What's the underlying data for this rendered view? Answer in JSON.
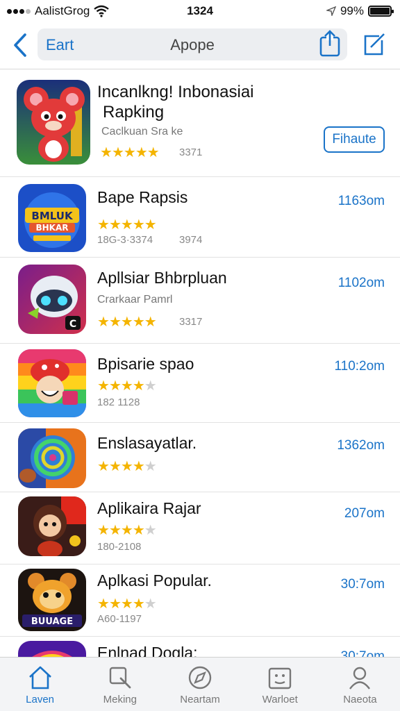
{
  "status_bar": {
    "carrier": "AalistGrog",
    "time": "1324",
    "battery": "99%",
    "battery_level": 0.99
  },
  "nav": {
    "back_label": "Eart",
    "title": "Apope"
  },
  "apps": [
    {
      "name_line1": "Incanlkng! Inbonasiai",
      "name_line2": "Rapking",
      "subtitle": "Caclkuan Sra ke",
      "stars_full": 4,
      "stars_half": 1,
      "rating_count": "3371",
      "action_label": "Fihaute",
      "icon": "red-mouse-app-icon"
    },
    {
      "name": "Bape Rapsis",
      "stars_full": 4,
      "stars_half": 1,
      "meta": "18G-3·3374",
      "rating_count": "3974",
      "size": "1163om",
      "icon": "bmluk-game-app-icon"
    },
    {
      "name": "Apllsiar Bhbrpluan",
      "subtitle": "Crarkaar Pamrl",
      "stars_full": 4,
      "stars_half": 1,
      "rating_count": "3317",
      "size": "1102om",
      "icon": "robot-app-icon"
    },
    {
      "name": "Bpisarie spao",
      "stars_full": 4,
      "stars_half": 0,
      "meta": "182 1128",
      "size": "110:2om",
      "icon": "mushroom-app-icon"
    },
    {
      "name": "Enslasayatlar.",
      "stars_full": 4,
      "stars_half": 0,
      "size": "1362om",
      "icon": "spiral-app-icon"
    },
    {
      "name": "Aplikaira Rajar",
      "stars_full": 4,
      "stars_half": 0,
      "meta": "180-2108",
      "size": "207om",
      "icon": "girl-character-app-icon"
    },
    {
      "name": "Aplkasi Popular.",
      "stars_full": 4,
      "stars_half": 0,
      "meta": "A60-1197",
      "size": "30:7om",
      "icon": "buuage-app-icon"
    },
    {
      "name": "Enlnad Dogla:",
      "size": "30:7om",
      "icon": "rainbow-app-icon"
    }
  ],
  "tabs": [
    {
      "label": "Laven",
      "icon": "home-icon",
      "active": true
    },
    {
      "label": "Meking",
      "icon": "search-icon",
      "active": false
    },
    {
      "label": "Neartam",
      "icon": "compass-icon",
      "active": false
    },
    {
      "label": "Warloet",
      "icon": "wallet-icon",
      "active": false
    },
    {
      "label": "Naeota",
      "icon": "person-icon",
      "active": false
    }
  ]
}
